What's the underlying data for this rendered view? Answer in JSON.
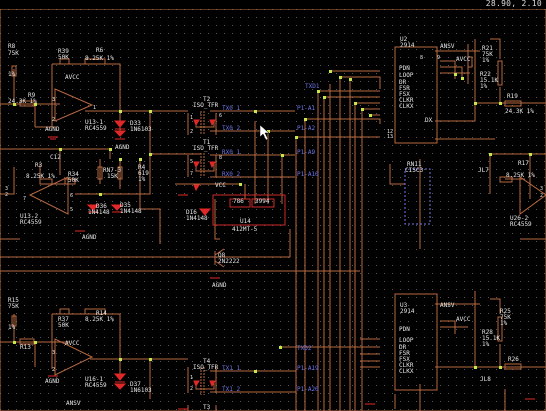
{
  "status": {
    "coord": "28.90, 2.10"
  },
  "colors": {
    "background": "#000000",
    "grid": "#5a5a5a",
    "wire": "#b96a42",
    "junction": "#c7e84a",
    "label_white": "#e6e6e6",
    "net_label": "#6f76e8",
    "part_outline": "#b96a42",
    "pin_red": "#e02828",
    "selection_box": "#d12a2a"
  },
  "refs": {
    "r8": "R8",
    "r8_val": "75K",
    "r8_tol": "1%",
    "r39": "R39",
    "r39_val": "50K",
    "r6": "R6",
    "r6_val": "8.25K 1%",
    "r9": "R9",
    "r9_val": "24.3K 1%",
    "u13a": "U13-1",
    "u13a_part": "RC4559",
    "u13a_pwr": "AVCC",
    "u13a_gnd": "AGND",
    "d33": "D33",
    "d33_part": "1N6103",
    "t2": "T2",
    "t2_part": "ISO_TFR",
    "t1": "T1",
    "t1_part": "ISO_TFR",
    "c12": "C12",
    "r3": "R3",
    "r3_val": "8.25K 1%",
    "r34": "R34",
    "r34_val": "50K",
    "rn7": "RN7-3",
    "rn7_val": "15K",
    "r4": "R4",
    "r4_val": "619",
    "r4_tol": "1%",
    "u13b": "U13-2",
    "u13b_part": "RC4559",
    "d36": "D36",
    "d36_part": "1N4148",
    "d35": "D35",
    "d35_part": "1N4148",
    "d16": "D16",
    "d16_part": "1N4148",
    "vcc": "VCC",
    "u14": "U14",
    "u14_part": "412MT-5",
    "lbl_786": "786",
    "lbl_3994": "3994",
    "q8": "Q8",
    "q8_part": "2N2222",
    "agnd": "AGND",
    "u2": "U2",
    "u2_part": "2914",
    "u2_pins": [
      "PDN",
      "LOOP",
      "DR",
      "FSR",
      "FSX",
      "CLKR",
      "CLKX"
    ],
    "u2_dx": "DX",
    "avcc": "AVCC",
    "ansv": "ANSV",
    "r21": "R21",
    "r21_val": "75K",
    "r21_tol": "1%",
    "r22": "R22",
    "r22_val": "15.1K",
    "r22_tol": "1%",
    "r19": "R19",
    "r19_val": "24.3K 1%",
    "rn11": "RN11",
    "rn11_part": "CISC3",
    "r17": "R17",
    "r17_val": "8.25K 1%",
    "jl7": "JL7",
    "u26": "U26-2",
    "u26_part": "RC4559",
    "u3": "U3",
    "u3_part": "2914",
    "r15": "R15",
    "r15_val": "75K",
    "r15_tol": "1%",
    "r37": "R37",
    "r37_val": "50K",
    "r14": "R14",
    "r14_val": "8.25K 1%",
    "r13": "R13",
    "u16": "U16-1",
    "u16_part": "RC4559",
    "d37": "D37",
    "d37_part": "1N6103",
    "t4": "T4",
    "t4_part": "ISO_TFR",
    "t3": "T3",
    "r25": "R25",
    "r25_val": "75K",
    "r25_tol": "1%",
    "r28": "R28",
    "r28_val": "15.1K",
    "r28_tol": "1%",
    "r26": "R26",
    "jl8": "JL8"
  },
  "nets": {
    "txd1": "TXD1",
    "txd2": "TXD2",
    "tx01": "TX0_1",
    "tx02": "TX0_2",
    "rx01": "RX0_1",
    "rx02": "RX0_2",
    "p1a1": "P1-A1",
    "p1a2": "P1-A2",
    "p1a9": "P1-A9",
    "p1a10": "P1-A10",
    "tx11": "TX1_1",
    "tx12": "TX1_2",
    "p1a19": "P1-A19",
    "p1a20": "P1-A20"
  }
}
